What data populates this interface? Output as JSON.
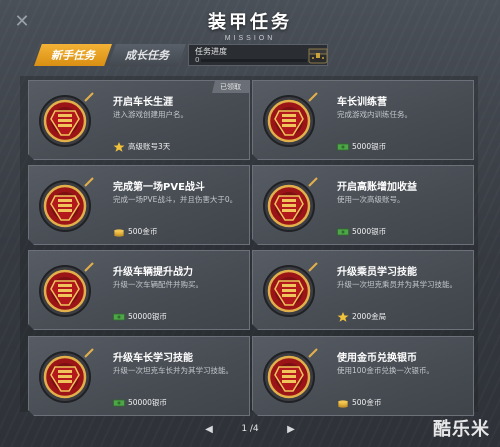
{
  "header": {
    "title": "装甲任务",
    "subtitle": "MISSION",
    "close_icon": "close-icon"
  },
  "tabs": [
    {
      "label": "新手任务",
      "active": true
    },
    {
      "label": "成长任务",
      "active": false
    }
  ],
  "progress": {
    "label": "任务进度",
    "value": "0",
    "fraction": 0
  },
  "colors": {
    "accent": "#e9a82d",
    "tab_active": "#f4b336",
    "card_bg": "#50555c",
    "medal_red": "#a3161a",
    "medal_gold": "#e2b04a"
  },
  "tasks": [
    {
      "title": "开启车长生涯",
      "desc": "进入游戏创建用户名。",
      "reward": "高级账号3天",
      "reward_icon": "star-icon",
      "badge": "已领取"
    },
    {
      "title": "车长训练营",
      "desc": "完成游戏内训练任务。",
      "reward": "5000银币",
      "reward_icon": "cash-icon",
      "badge": ""
    },
    {
      "title": "完成第一场PVE战斗",
      "desc": "完成一场PVE战斗，并且伤害大于0。",
      "reward": "500金币",
      "reward_icon": "gold-coins-icon",
      "badge": ""
    },
    {
      "title": "开启高账增加收益",
      "desc": "使用一次高级账号。",
      "reward": "5000银币",
      "reward_icon": "cash-icon",
      "badge": ""
    },
    {
      "title": "升级车辆提升战力",
      "desc": "升级一次车辆配件并购买。",
      "reward": "50000银币",
      "reward_icon": "cash-icon",
      "badge": ""
    },
    {
      "title": "升级乘员学习技能",
      "desc": "升级一次坦克乘员并为其学习技能。",
      "reward": "2000金局",
      "reward_icon": "star-icon",
      "badge": ""
    },
    {
      "title": "升级车长学习技能",
      "desc": "升级一次坦克车长并为其学习技能。",
      "reward": "50000银币",
      "reward_icon": "cash-icon",
      "badge": ""
    },
    {
      "title": "使用金币兑换银币",
      "desc": "使用100金币兑换一次银币。",
      "reward": "500金币",
      "reward_icon": "gold-coins-icon",
      "badge": ""
    }
  ],
  "pager": {
    "text": "1 /4",
    "prev_icon": "triangle-left-icon",
    "next_icon": "triangle-right-icon"
  },
  "watermark": "酷乐米"
}
